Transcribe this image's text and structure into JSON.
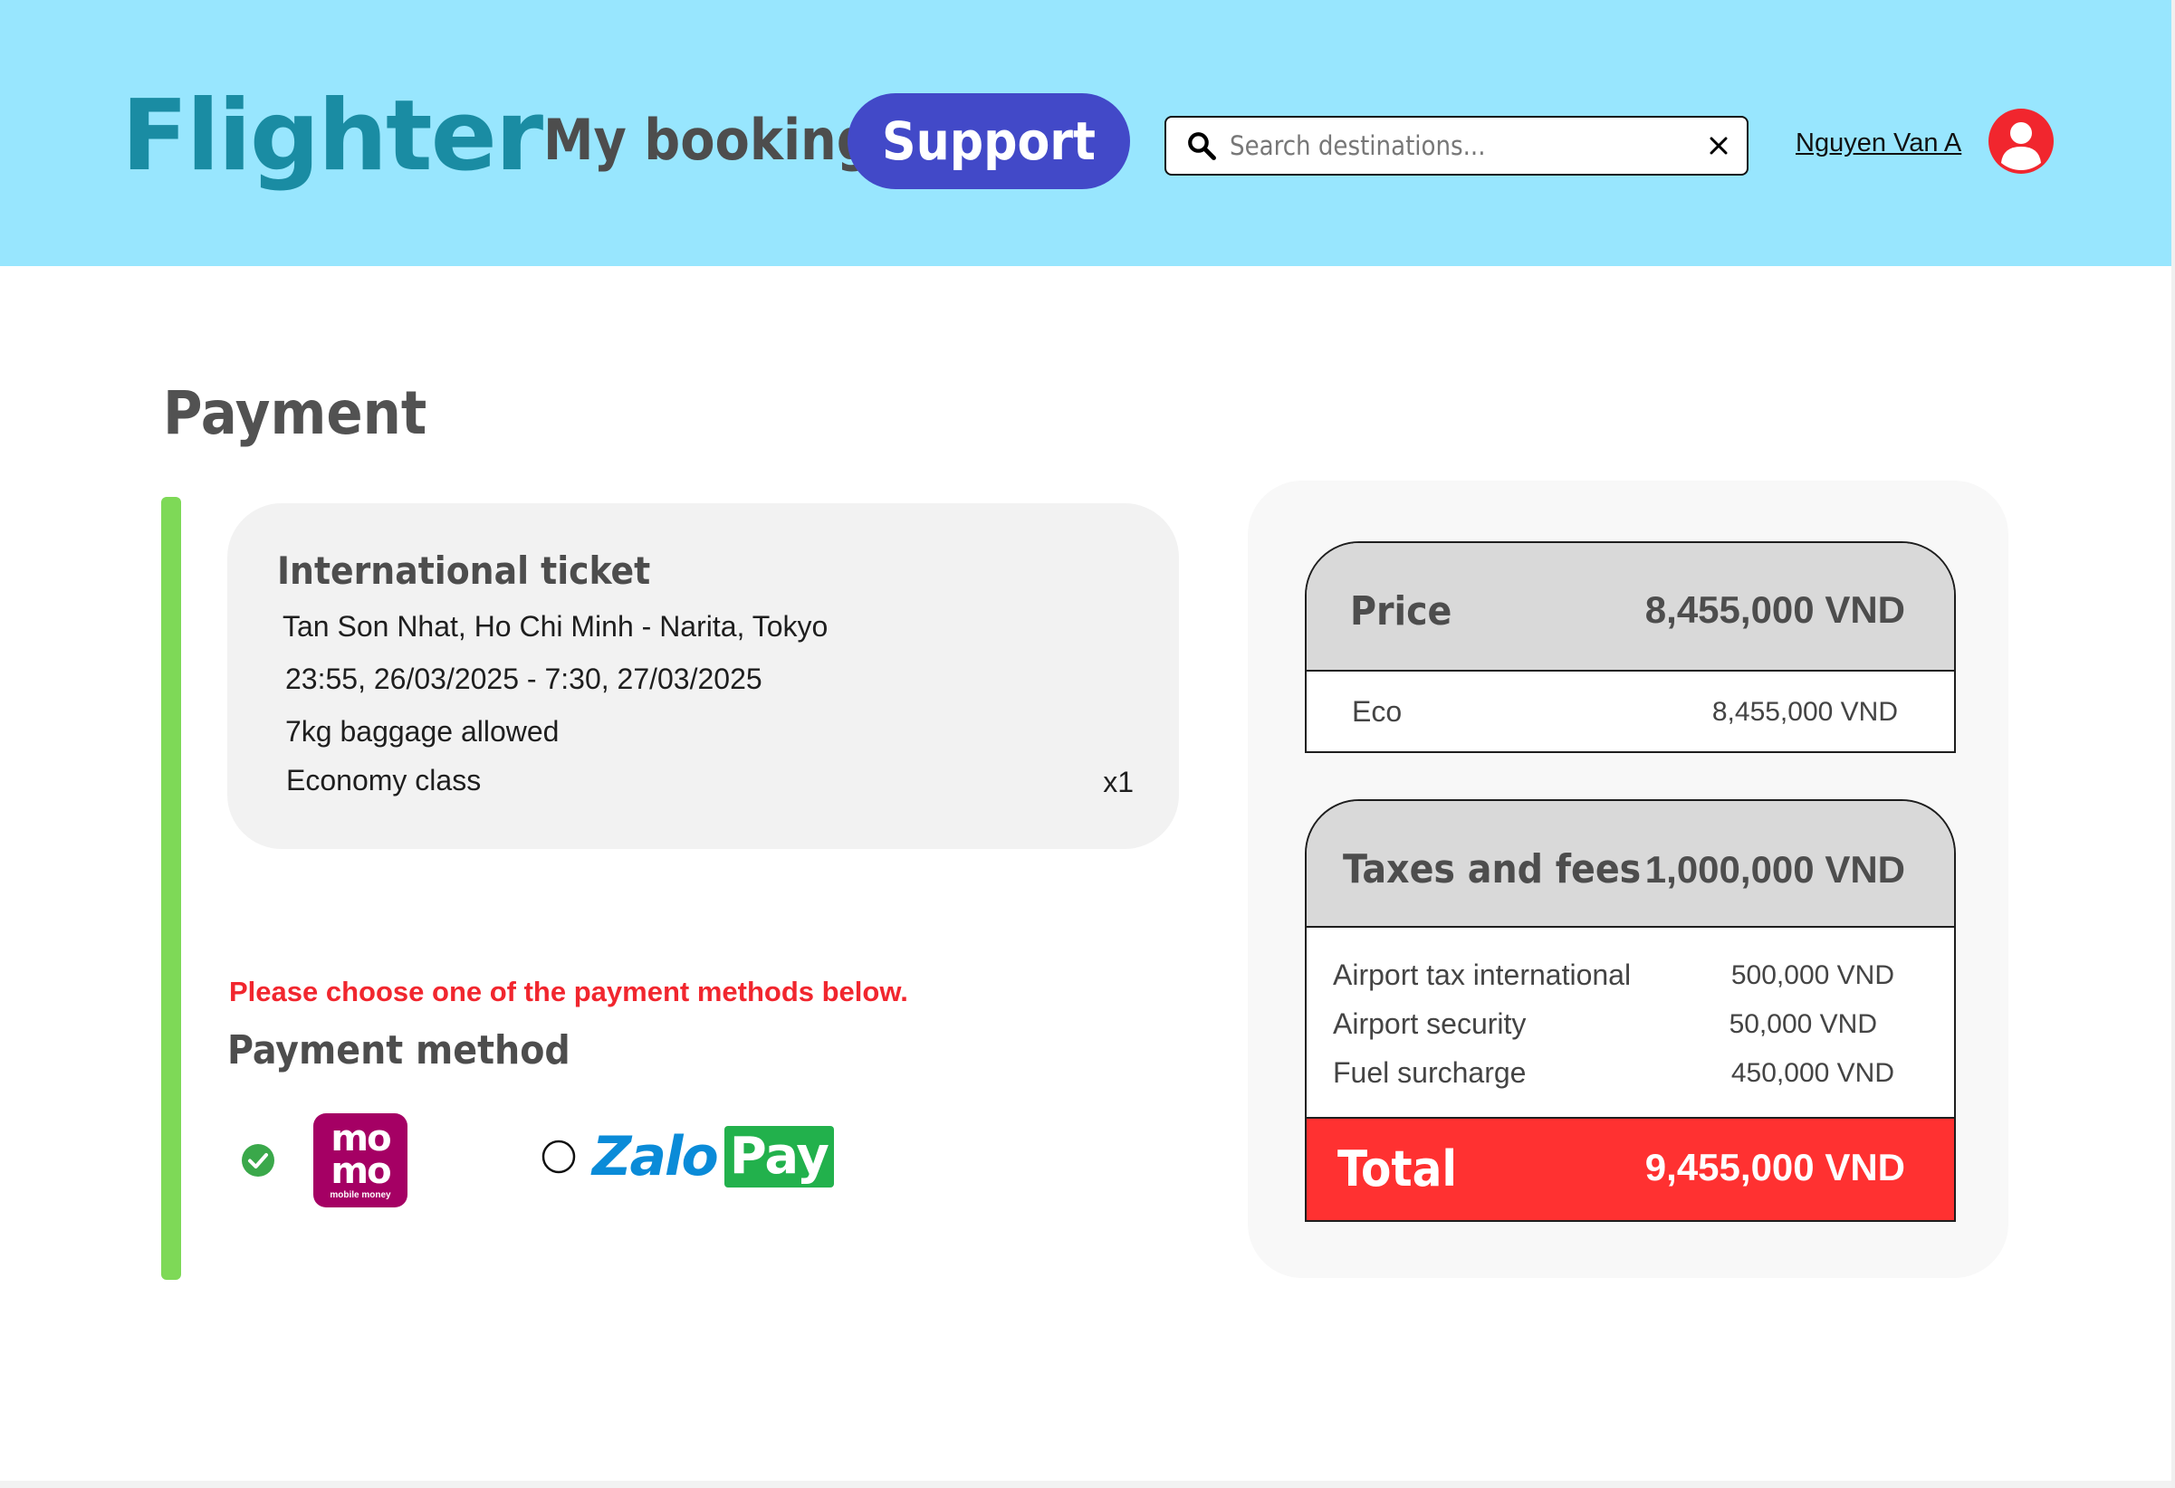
{
  "header": {
    "logo": "Flighter",
    "nav": {
      "my_booking": "My booking",
      "support": "Support"
    },
    "search": {
      "placeholder": "Search destinations..."
    },
    "user": {
      "name": "Nguyen Van A"
    }
  },
  "page": {
    "title": "Payment"
  },
  "ticket": {
    "title": "International ticket",
    "route": "Tan Son Nhat, Ho Chi Minh - Narita, Tokyo",
    "time": "23:55, 26/03/2025 - 7:30, 27/03/2025",
    "baggage": "7kg baggage allowed",
    "class": "Economy class",
    "quantity": "x1"
  },
  "payment": {
    "warning": "Please choose one of the payment methods below.",
    "title": "Payment method",
    "methods": [
      {
        "name": "momo",
        "logo_lines": [
          "mo",
          "mo"
        ],
        "logo_sub": "mobile money",
        "selected": true
      },
      {
        "name": "ZaloPay",
        "logo_text": "Zalo",
        "logo_badge": "Pay",
        "selected": false
      }
    ]
  },
  "summary": {
    "price": {
      "label": "Price",
      "amount": "8,455,000 VND",
      "rows": [
        {
          "label": "Eco",
          "amount": "8,455,000 VND"
        }
      ]
    },
    "taxes": {
      "label": "Taxes and fees",
      "amount": "1,000,000 VND",
      "rows": [
        {
          "label": "Airport tax international",
          "amount": "500,000 VND"
        },
        {
          "label": "Airport security",
          "amount": "50,000 VND"
        },
        {
          "label": "Fuel surcharge",
          "amount": "450,000 VND"
        }
      ]
    },
    "total": {
      "label": "Total",
      "amount": "9,455,000 VND"
    }
  },
  "colors": {
    "header_bg": "#98e6fe",
    "logo": "#1a8ca3",
    "support_button": "#4249c8",
    "accent_bar": "#7ed957",
    "warning": "#f1262e",
    "total_bg": "#ff3131",
    "avatar": "#f1262e",
    "check": "#3aa84a"
  }
}
